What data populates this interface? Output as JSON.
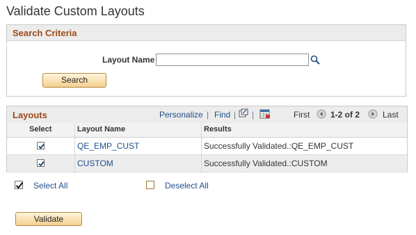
{
  "page": {
    "title": "Validate Custom Layouts"
  },
  "search": {
    "section_title": "Search Criteria",
    "layout_name_label": "Layout Name",
    "layout_name_value": "",
    "search_button": "Search"
  },
  "layouts": {
    "title": "Layouts",
    "personalize": "Personalize",
    "find": "Find",
    "pipe": "|",
    "first": "First",
    "range": "1-2 of 2",
    "last": "Last",
    "columns": [
      "Select",
      "Layout Name",
      "Results"
    ],
    "rows": [
      {
        "selected": true,
        "name": "QE_EMP_CUST",
        "result": "Successfully Validated.:QE_EMP_CUST"
      },
      {
        "selected": true,
        "name": "CUSTOM",
        "result": "Successfully Validated.:CUSTOM"
      }
    ]
  },
  "actions": {
    "select_all": "Select All",
    "deselect_all": "Deselect All",
    "validate_button": "Validate"
  },
  "colors": {
    "accent": "#9b4a18",
    "link": "#1f4e8c",
    "button": "#f5d08f"
  }
}
